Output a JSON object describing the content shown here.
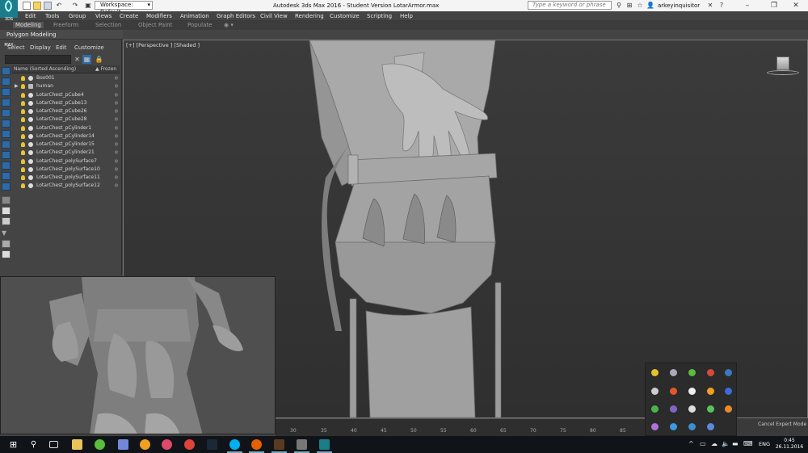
{
  "app": {
    "window_title": "Autodesk 3ds Max 2016 - Student Version    LotarArmor.max",
    "app_icon_label": "3DS MAX",
    "workspace": "Workspace: Default",
    "search_placeholder": "Type a keyword or phrase",
    "user": "arkeyinquisitor"
  },
  "menu": [
    "Edit",
    "Tools",
    "Group",
    "Views",
    "Create",
    "Modifiers",
    "Animation",
    "Graph Editors",
    "Civil View",
    "Rendering",
    "Customize",
    "Scripting",
    "Help"
  ],
  "ribbon": {
    "tabs": [
      "Modeling",
      "Freeform",
      "Selection",
      "Object Paint",
      "Populate"
    ],
    "active_tab": "Modeling",
    "panel": "Polygon Modeling"
  },
  "explorer": {
    "menu": [
      "Select",
      "Display",
      "Edit",
      "Customize"
    ],
    "col_name": "Name (Sorted Ascending)",
    "col_frozen": "▲ Frozen",
    "rows": [
      {
        "name": "Box001",
        "kind": "obj"
      },
      {
        "name": "human",
        "kind": "group"
      },
      {
        "name": "LotarChest_pCube4",
        "kind": "obj"
      },
      {
        "name": "LotarChest_pCube13",
        "kind": "obj"
      },
      {
        "name": "LotarChest_pCube26",
        "kind": "obj"
      },
      {
        "name": "LotarChest_pCube28",
        "kind": "obj"
      },
      {
        "name": "LotarChest_pCylinder1",
        "kind": "obj"
      },
      {
        "name": "LotarChest_pCylinder14",
        "kind": "obj"
      },
      {
        "name": "LotarChest_pCylinder15",
        "kind": "obj"
      },
      {
        "name": "LotarChest_pCylinder21",
        "kind": "obj"
      },
      {
        "name": "LotarChest_polySurface7",
        "kind": "obj"
      },
      {
        "name": "LotarChest_polySurface10",
        "kind": "obj"
      },
      {
        "name": "LotarChest_polySurface11",
        "kind": "obj"
      },
      {
        "name": "LotarChest_polySurface12",
        "kind": "obj"
      }
    ]
  },
  "viewport": {
    "label": "[+] [Perspective ] [Shaded ]"
  },
  "timeline": {
    "ticks": [
      "30",
      "35",
      "40",
      "45",
      "50",
      "55",
      "60",
      "65",
      "70",
      "75",
      "80",
      "85"
    ],
    "expert_label": "Cancel Expert Mode"
  },
  "taskbar": {
    "lang": "ENG",
    "time": "0:45",
    "date": "26.11.2016"
  },
  "colors": {
    "accent": "#1b7d8a",
    "viewport_bg": "#353535",
    "panel_bg": "#444444",
    "selection_blue": "#2f6aa5"
  }
}
